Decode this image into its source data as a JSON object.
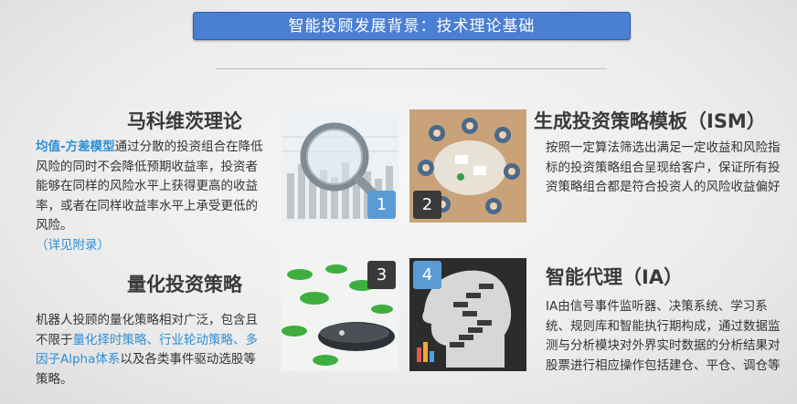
{
  "header": {
    "title": "智能投顾发展背景：技术理论基础"
  },
  "section1": {
    "heading": "马科维茨理论",
    "highlight": "均值-方差模型",
    "body": "通过分散的投资组合在降低风险的同时不会降低预期收益率，投资者能够在同样的风险水平上获得更高的收益率，或者在同样收益率水平上承受更低的风险。",
    "link": "（详见附录）"
  },
  "section2": {
    "heading": "量化投资策略",
    "body_a": "机器人投顾的量化策略相对广泛，包含且不限于",
    "highlight": "量化择时策略、行业轮动策略、多因子Alpha体系",
    "body_b": "以及各类事件驱动选股等策略。"
  },
  "section3": {
    "heading": "生成投资策略模板（ISM）",
    "body": "按照一定算法筛选出满足一定收益和风险指标的投资策略组合呈现给客户，保证所有投资策略组合都是符合投资人的风险收益偏好"
  },
  "section4": {
    "heading": "智能代理（IA）",
    "body": "IA由信号事件监听器、决策系统、学习系统、规则库和智能执行期构成，通过数据监测与分析模块对外界实时数据的分析结果对股票进行相应操作包括建仓、平仓、调仓等"
  },
  "tiles": [
    {
      "number": "1",
      "icon": "magnifier-chart-icon",
      "badge_color": "#5b9bd5"
    },
    {
      "number": "2",
      "icon": "team-meeting-icon",
      "badge_color": "#3a3a3a"
    },
    {
      "number": "3",
      "icon": "pills-icon",
      "badge_color": "#3a3a3a"
    },
    {
      "number": "4",
      "icon": "head-stairs-icon",
      "badge_color": "#5b9bd5"
    }
  ]
}
